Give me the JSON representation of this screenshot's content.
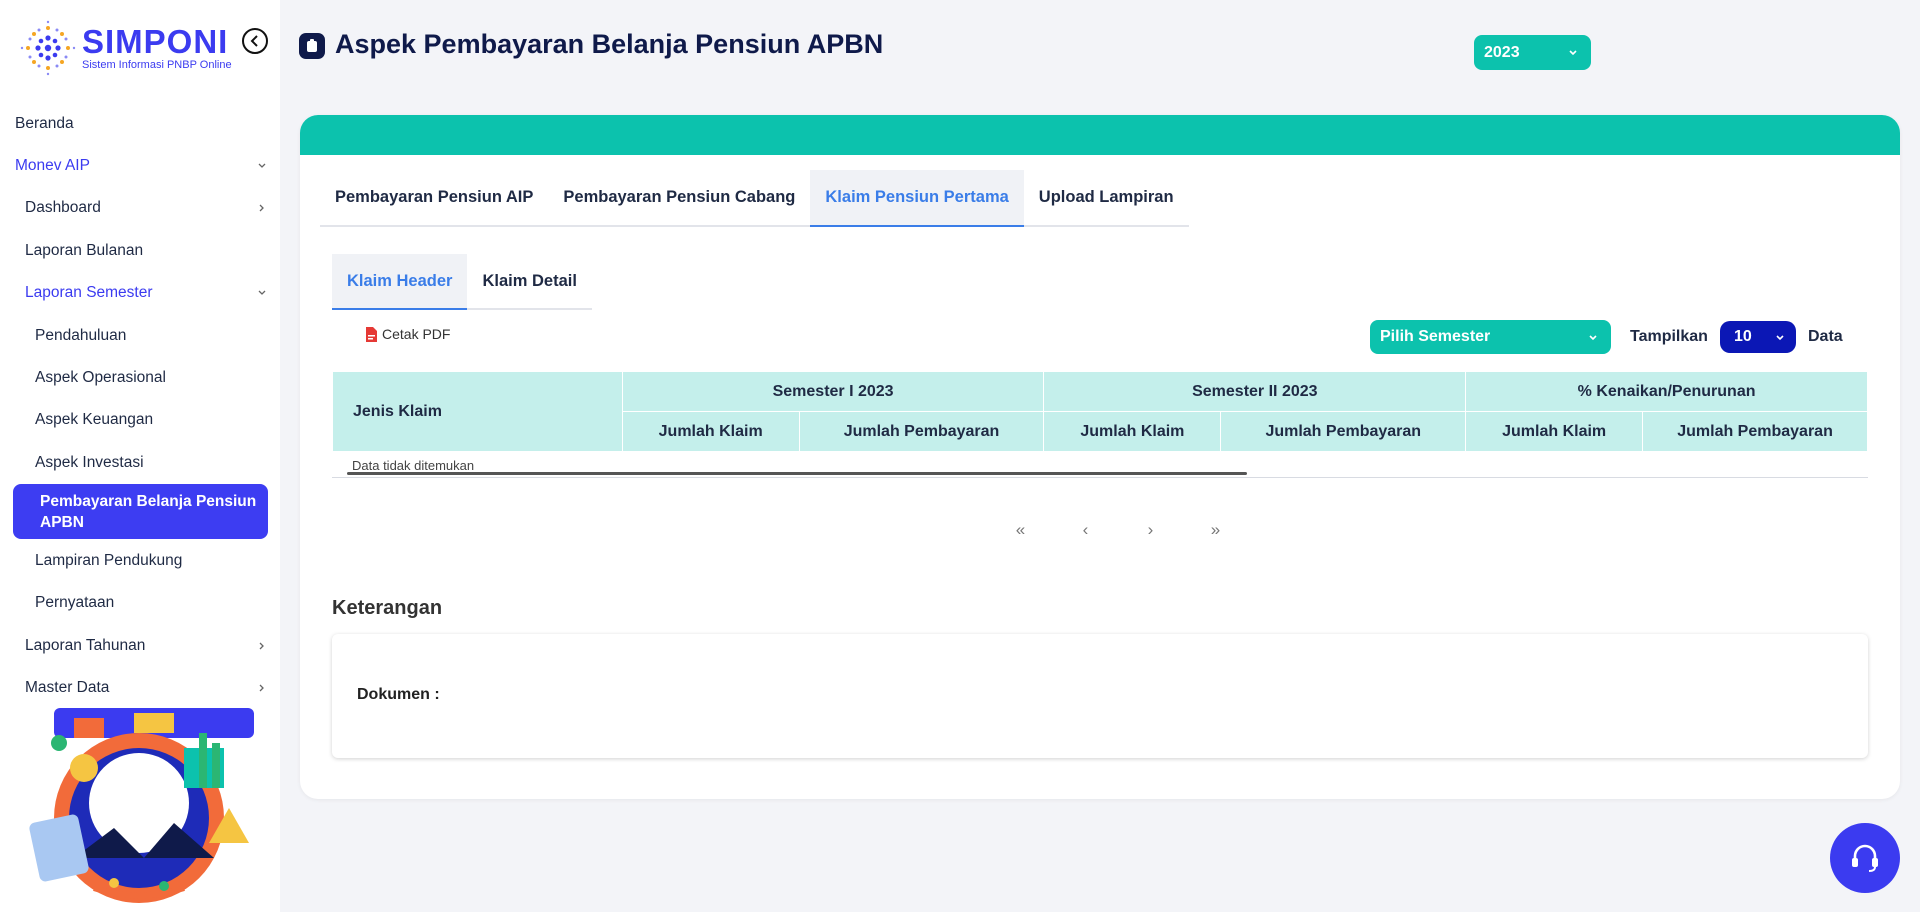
{
  "brand": {
    "name": "SIMPONI",
    "tagline": "Sistem Informasi PNBP Online"
  },
  "sidebar": {
    "items": [
      {
        "label": "Beranda"
      },
      {
        "label": "Monev AIP"
      },
      {
        "label": "Dashboard"
      },
      {
        "label": "Laporan Bulanan"
      },
      {
        "label": "Laporan Semester"
      },
      {
        "label": "Pendahuluan"
      },
      {
        "label": "Aspek Operasional"
      },
      {
        "label": "Aspek Keuangan"
      },
      {
        "label": "Aspek Investasi"
      },
      {
        "label": "Pembayaran Belanja Pensiun APBN"
      },
      {
        "label": "Lampiran Pendukung"
      },
      {
        "label": "Pernyataan"
      },
      {
        "label": "Laporan Tahunan"
      },
      {
        "label": "Master Data"
      }
    ]
  },
  "header": {
    "title": "Aspek Pembayaran Belanja Pensiun APBN",
    "year": "2023"
  },
  "tabs": [
    {
      "label": "Pembayaran Pensiun AIP"
    },
    {
      "label": "Pembayaran Pensiun Cabang"
    },
    {
      "label": "Klaim Pensiun Pertama"
    },
    {
      "label": "Upload Lampiran"
    }
  ],
  "subtabs": [
    {
      "label": "Klaim Header"
    },
    {
      "label": "Klaim Detail"
    }
  ],
  "toolbar": {
    "pdf_label": "Cetak PDF",
    "semester_placeholder": "Pilih Semester",
    "show_label": "Tampilkan",
    "page_size": "10",
    "data_label": "Data"
  },
  "table": {
    "col_jenis": "Jenis Klaim",
    "groups": [
      "Semester I 2023",
      "Semester II 2023",
      "% Kenaikan/Penurunan"
    ],
    "sub": [
      "Jumlah Klaim",
      "Jumlah Pembayaran",
      "Jumlah Klaim",
      "Jumlah Pembayaran",
      "Jumlah Klaim",
      "Jumlah Pembayaran"
    ],
    "empty_text": "Data tidak ditemukan"
  },
  "pager": {
    "first": "«",
    "prev": "‹",
    "next": "›",
    "last": "»"
  },
  "keterangan": {
    "title": "Keterangan",
    "dokumen": "Dokumen :"
  },
  "colors": {
    "primary": "#3b3bf0",
    "teal": "#0cc2ad",
    "navy": "#0f1a4a",
    "table_header": "#c4efeb"
  }
}
